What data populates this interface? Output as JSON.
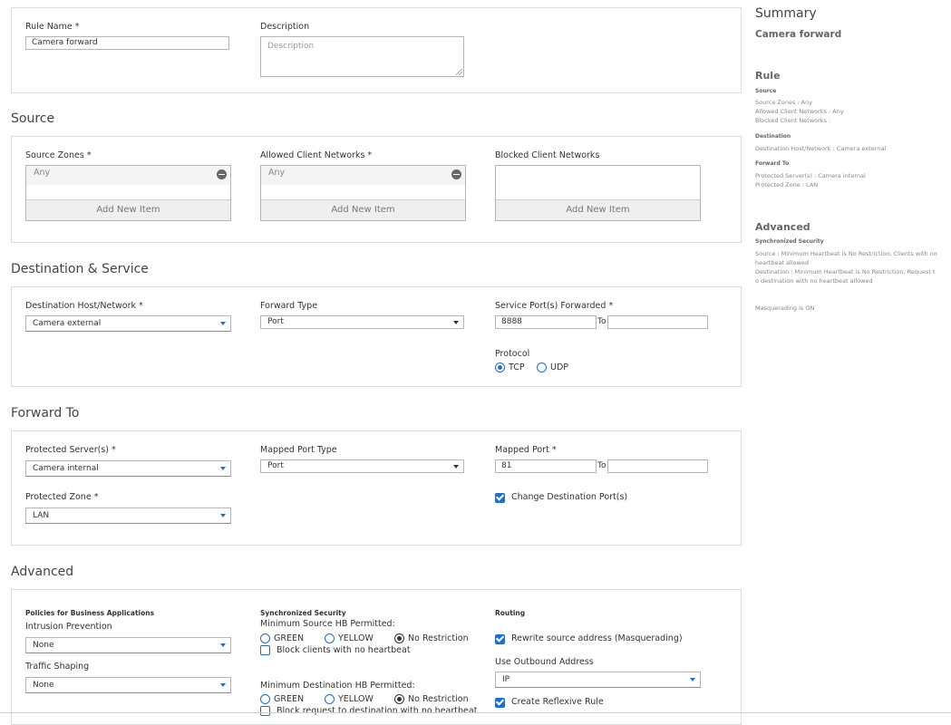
{
  "general": {
    "rule_name_label": "Rule Name *",
    "rule_name_value": "Camera forward",
    "description_label": "Description",
    "description_placeholder": "Description"
  },
  "source": {
    "title": "Source",
    "zones_label": "Source Zones *",
    "zones_item": "Any",
    "allowed_label": "Allowed Client Networks *",
    "allowed_item": "Any",
    "blocked_label": "Blocked Client Networks",
    "add_new_label": "Add New Item"
  },
  "destination": {
    "title": "Destination & Service",
    "host_label": "Destination Host/Network *",
    "host_value": "Camera external",
    "forward_type_label": "Forward Type",
    "forward_type_value": "Port",
    "service_port_label": "Service Port(s) Forwarded *",
    "service_port_value": "8888",
    "to_label": "To",
    "protocol_label": "Protocol",
    "protocol_tcp": "TCP",
    "protocol_udp": "UDP"
  },
  "forward_to": {
    "title": "Forward To",
    "servers_label": "Protected Server(s) *",
    "servers_value": "Camera internal",
    "mapped_port_type_label": "Mapped Port Type",
    "mapped_port_type_value": "Port",
    "mapped_port_label": "Mapped Port *",
    "mapped_port_value": "81",
    "to_label": "To",
    "zone_label": "Protected Zone *",
    "zone_value": "LAN",
    "change_dest_label": "Change Destination Port(s)"
  },
  "advanced": {
    "title": "Advanced",
    "policies_heading": "Policies for Business Applications",
    "ips_label": "Intrusion Prevention",
    "ips_value": "None",
    "shaping_label": "Traffic Shaping",
    "shaping_value": "None",
    "sync_heading": "Synchronized Security",
    "min_source_label": "Minimum Source HB Permitted:",
    "green": "GREEN",
    "yellow": "YELLOW",
    "no_restriction": "No Restriction",
    "block_clients_label": "Block clients with no heartbeat",
    "min_dest_label": "Minimum Destination HB Permitted:",
    "block_request_label": "Block request to destination with no heartbeat",
    "routing_heading": "Routing",
    "rewrite_label": "Rewrite source address (Masquerading)",
    "outbound_label": "Use Outbound Address",
    "outbound_value": "IP",
    "reflexive_label": "Create Reflexive Rule"
  },
  "summary": {
    "title": "Summary",
    "rule_name": "Camera forward",
    "rule_heading": "Rule",
    "source_heading": "Source",
    "source_zones": "Source Zones : Any",
    "allowed_networks": "Allowed Client Networks : Any",
    "blocked_networks": "Blocked Client Networks :",
    "destination_heading": "Destination",
    "destination_host": "Destination Host/Network : Camera external",
    "forward_to_heading": "Forward To",
    "protected_servers": "Protected Server(s) : Camera internal",
    "protected_zone": "Protected Zone : LAN",
    "advanced_heading": "Advanced",
    "sync_heading": "Synchronized Security",
    "sync_source_1": "Source : Minimum Heartbeat is No Restriction, Clients with no",
    "sync_source_2": "heartbeat allowed",
    "sync_dest_1": "Destination : Minimum Heartbeat is No Restriction, Request t",
    "sync_dest_2": "o destination with no heartbeat allowed",
    "masquerading": "Masquerading is ON"
  },
  "colors": {
    "accent": "#1f6fd0",
    "border": "#dcdcdc"
  }
}
